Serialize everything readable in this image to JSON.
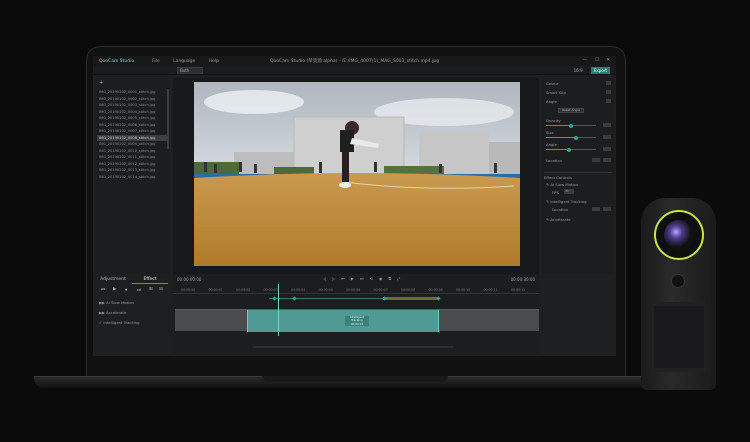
{
  "app": {
    "logo": "QooCam Studio",
    "menus": [
      "File",
      "Language",
      "Help"
    ],
    "window_title": "QooCam Studio (单资源 alpha) - /E:/IMG_4007(1)_MAG_S003_stitch.mp4.jpg",
    "window_controls": [
      "—",
      "☐",
      "✕"
    ]
  },
  "toolbar": {
    "mode_select": "Both",
    "right_items": [
      "16:9",
      "Export"
    ]
  },
  "files": {
    "add": "+",
    "items": [
      "IMG_20190102_0001_stitch.jpg",
      "IMG_20190102_0002_stitch.jpg",
      "IMG_20190102_0003_stitch.jpg",
      "IMG_20190102_0004_stitch.jpg",
      "IMG_20190102_0005_stitch.jpg",
      "IMG_20190102_0006_stitch.jpg",
      "IMG_20190102_0007_stitch.jpg",
      "IMG_20190102_0008_stitch.jpg",
      "IMG_20190102_0009_stitch.jpg",
      "IMG_20190102_0010_stitch.jpg",
      "IMG_20190102_0011_stitch.jpg",
      "IMG_20190102_0012_stitch.jpg",
      "IMG_20190102_0013_stitch.jpg",
      "IMG_20190102_0014_stitch.jpg"
    ],
    "selected_index": 7
  },
  "properties": {
    "sections": [
      "Colour",
      "Smart Clip",
      "Angle"
    ],
    "reset_button": "Reset Angle",
    "sliders": [
      {
        "label": "Opacity",
        "value": 0.5
      },
      {
        "label": "Size",
        "value": 0.6
      },
      {
        "label": "Angle",
        "value": 0.45
      }
    ],
    "location_label": "Location",
    "effect_controls": "Effect Controls",
    "fx1": "✎ AI Slow Motion",
    "fx1_fps_label": "FPS",
    "fx1_fps_value": "30",
    "fx2": "✎ Intelligent Tracking",
    "fx2_loc": "Location",
    "fx3": "✎ Accelerate"
  },
  "bottom_left": {
    "tabs": [
      "Adjustment",
      "Effect"
    ],
    "active_tab": 1,
    "controls": [
      "⏮",
      "▶",
      "⏺",
      "⏭",
      "⊞",
      "⊟"
    ],
    "tracks": [
      "▶▶ AI Slow Motion",
      "▶▶ Accelerate",
      "✓ Intelligent Tracking"
    ]
  },
  "timeline": {
    "current_time": "00:00:00:00",
    "end_time": "00:00:30:00",
    "transport": [
      "◁",
      "▷",
      "⏮",
      "▶",
      "⏭",
      "⟲",
      "◉",
      "⧉",
      "⤢"
    ],
    "ruler_labels": [
      "00:00:00",
      "00:00:01",
      "00:00:02",
      "00:00:03",
      "00:00:04",
      "00:00:05",
      "00:00:06",
      "00:00:07",
      "00:00:08",
      "00:00:09",
      "00:00:10",
      "00:00:11",
      "00:00:12"
    ],
    "clip_label_lines": [
      "Intelligent",
      "Tracking",
      "00:00:03"
    ]
  },
  "colors": {
    "accent": "#2fa394",
    "clip_selected": "#4f9a95",
    "lens_ring": "#c3e64a"
  }
}
